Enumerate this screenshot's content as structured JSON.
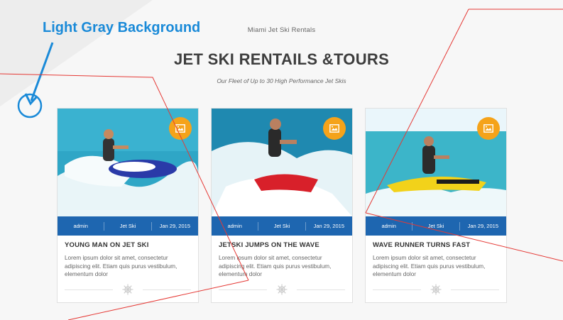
{
  "annotation": {
    "label": "Light Gray Background"
  },
  "header": {
    "eyebrow": "Miami Jet Ski Rentals",
    "title": "JET SKI RENTAILS &TOURS",
    "subtitle": "Our Fleet of Up to 30 High Performance Jet Skis"
  },
  "cards": [
    {
      "author": "admin",
      "category": "Jet Ski",
      "date": "Jan 29, 2015",
      "title": "YOUNG MAN ON JET SKI",
      "body": "Lorem ipsum dolor sit amet, consectetur adipiscing elit. Etiam quis purus vestibulum, elementum dolor",
      "badge_icon": "image-icon",
      "watercraft_color": "#2a3aa8"
    },
    {
      "author": "admin",
      "category": "Jet Ski",
      "date": "Jan 29, 2015",
      "title": "JETSKI JUMPS ON THE WAVE",
      "body": "Lorem ipsum dolor sit amet, consectetur adipiscing elit. Etiam quis purus vestibulum, elementum dolor",
      "badge_icon": "image-icon",
      "watercraft_color": "#d8202a"
    },
    {
      "author": "admin",
      "category": "Jet Ski",
      "date": "Jan 29, 2015",
      "title": "WAVE RUNNER TURNS FAST",
      "body": "Lorem ipsum dolor sit amet, consectetur adipiscing elit. Etiam quis purus vestibulum, elementum dolor",
      "badge_icon": "image-icon",
      "watercraft_color": "#f2d21a"
    }
  ],
  "colors": {
    "accent_blue": "#1e66b0",
    "badge_orange": "#f5a31a",
    "annotation_blue": "#1a8ad8",
    "guide_red": "#e53935"
  }
}
